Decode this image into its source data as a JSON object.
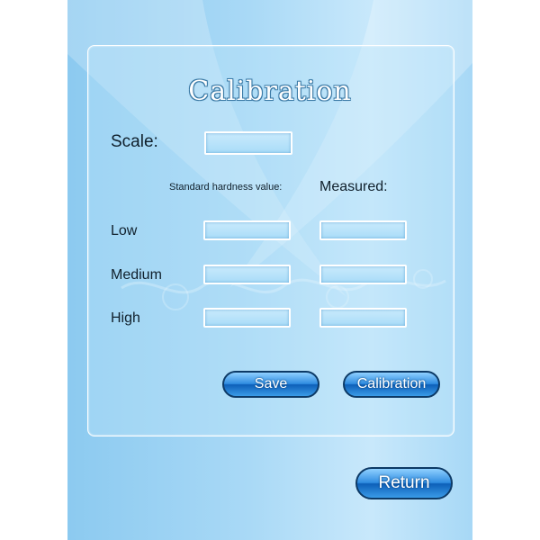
{
  "title": "Calibration",
  "scale": {
    "label": "Scale:",
    "value": ""
  },
  "headers": {
    "standard": "Standard hardness value:",
    "measured": "Measured:"
  },
  "rows": [
    {
      "label": "Low",
      "standard_value": "",
      "measured_value": ""
    },
    {
      "label": "Medium",
      "standard_value": "",
      "measured_value": ""
    },
    {
      "label": "High",
      "standard_value": "",
      "measured_value": ""
    }
  ],
  "buttons": {
    "save": "Save",
    "calibration": "Calibration",
    "return": "Return"
  },
  "colors": {
    "background": "#a9d9f6",
    "button": "#1f7fd6",
    "title": "#ffffff"
  }
}
